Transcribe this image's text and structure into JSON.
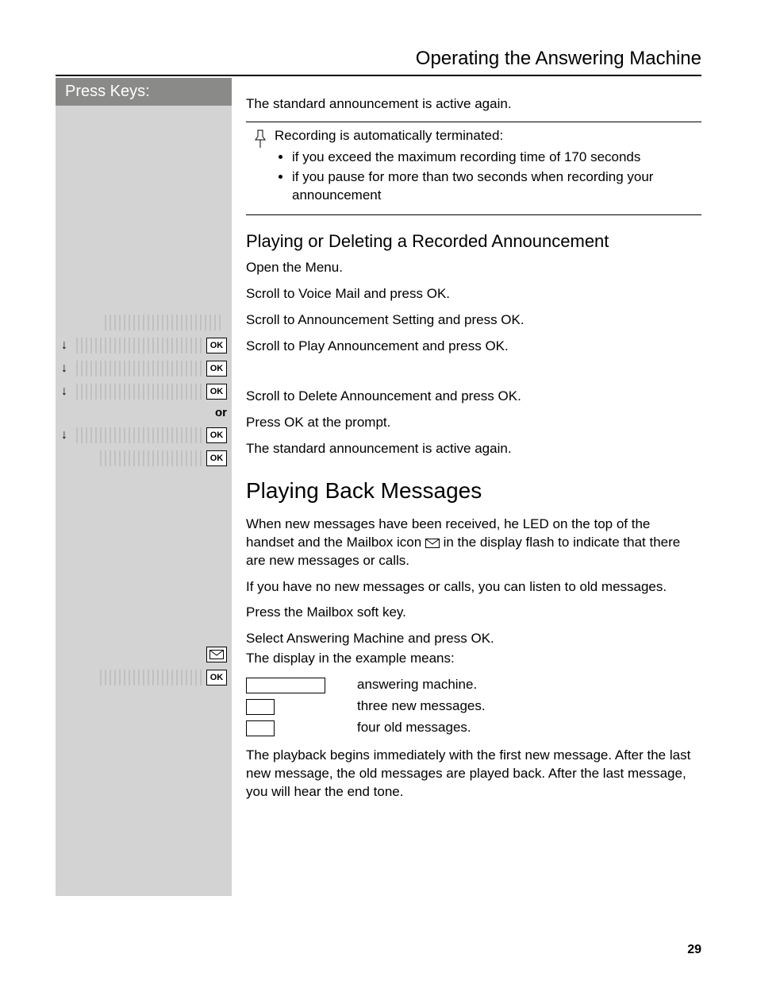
{
  "header": {
    "title": "Operating the Answering Machine"
  },
  "sidebar": {
    "header": "Press Keys:"
  },
  "intro": {
    "active_again": "The standard announcement is active again."
  },
  "note": {
    "lead": "Recording is automatically terminated:",
    "b1": "if you exceed the maximum recording time of 170 seconds",
    "b2": "if you pause for more than two seconds when recording your announcement"
  },
  "play_delete": {
    "heading": "Playing or Deleting a Recorded Announcement",
    "s1": "Open the Menu.",
    "s2": "Scroll to Voice Mail and press OK.",
    "s3": "Scroll to Announcement Setting and press OK.",
    "s4": "Scroll to Play Announcement and press OK.",
    "or": "or",
    "s5": "Scroll to Delete Announcement and press OK.",
    "s6": "Press OK at the prompt.",
    "s7": "The standard announcement is active again."
  },
  "playback": {
    "heading": "Playing Back Messages",
    "p1a": "When new messages have been received,  he LED on the top of the handset and the Mailbox icon ",
    "p1b": " in the display flash to indicate that there are new messages or calls.",
    "p2": "If you have no new messages or calls, you can listen to old messages.",
    "p3": "Press the Mailbox soft key.",
    "p4a": "Select Answering Machine and press OK.",
    "p4b": "The display in the example means:",
    "legend1": "answering machine.",
    "legend2": "three new messages.",
    "legend3": "four old messages.",
    "p5": "The playback begins immediately with the first new message. After the last new message, the old messages are played back. After the last message, you will hear the end tone."
  },
  "key_labels": {
    "ok": "OK"
  },
  "page_number": "29"
}
